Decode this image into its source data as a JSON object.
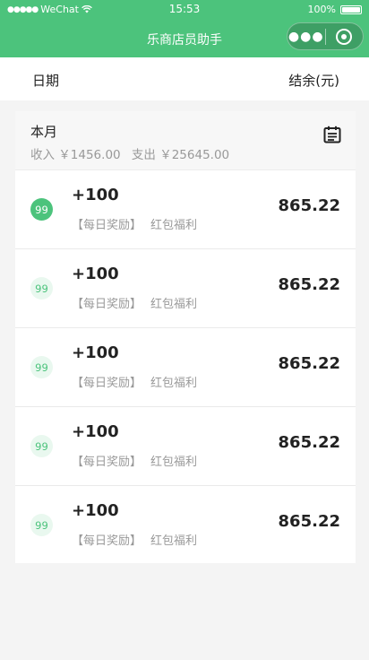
{
  "status_bar": {
    "carrier": "WeChat",
    "time": "15:53",
    "battery": "100%"
  },
  "nav": {
    "title": "乐商店员助手",
    "more_icon": "●●●"
  },
  "columns": {
    "date": "日期",
    "balance": "结余(元)"
  },
  "summary": {
    "month": "本月",
    "income": "收入 ￥1456.00",
    "expense": "支出 ￥25645.00"
  },
  "records": [
    {
      "badge": "99",
      "amount": "+100",
      "tag": "【每日奖励】",
      "desc": "红包福利",
      "balance": "865.22",
      "active": true
    },
    {
      "badge": "99",
      "amount": "+100",
      "tag": "【每日奖励】",
      "desc": "红包福利",
      "balance": "865.22",
      "active": false
    },
    {
      "badge": "99",
      "amount": "+100",
      "tag": "【每日奖励】",
      "desc": "红包福利",
      "balance": "865.22",
      "active": false
    },
    {
      "badge": "99",
      "amount": "+100",
      "tag": "【每日奖励】",
      "desc": "红包福利",
      "balance": "865.22",
      "active": false
    },
    {
      "badge": "99",
      "amount": "+100",
      "tag": "【每日奖励】",
      "desc": "红包福利",
      "balance": "865.22",
      "active": false
    }
  ],
  "colors": {
    "brand": "#4cc37c",
    "muted": "#999999"
  }
}
